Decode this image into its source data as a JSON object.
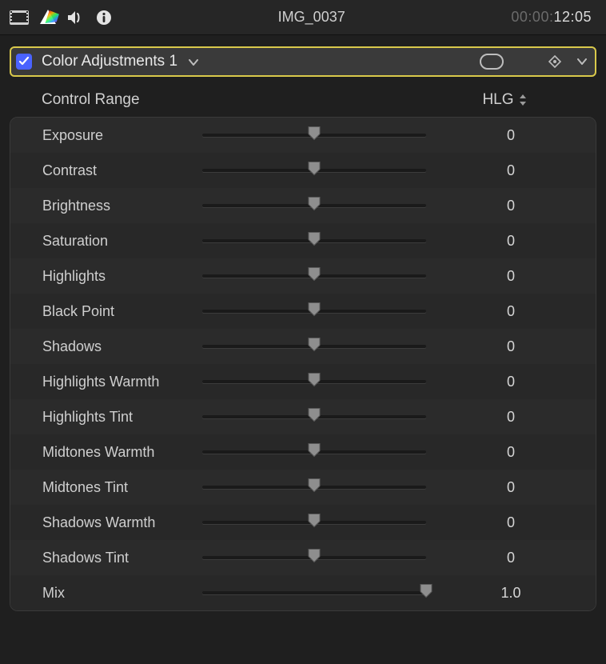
{
  "header": {
    "clip_title": "IMG_0037",
    "timecode_dim": "00:00:",
    "timecode_bright": "12:05"
  },
  "effect": {
    "enabled": true,
    "name": "Color Adjustments 1"
  },
  "control_range": {
    "label": "Control Range",
    "value": "HLG"
  },
  "params": [
    {
      "label": "Exposure",
      "value": "0",
      "pos": 0.5
    },
    {
      "label": "Contrast",
      "value": "0",
      "pos": 0.5
    },
    {
      "label": "Brightness",
      "value": "0",
      "pos": 0.5
    },
    {
      "label": "Saturation",
      "value": "0",
      "pos": 0.5
    },
    {
      "label": "Highlights",
      "value": "0",
      "pos": 0.5
    },
    {
      "label": "Black Point",
      "value": "0",
      "pos": 0.5
    },
    {
      "label": "Shadows",
      "value": "0",
      "pos": 0.5
    },
    {
      "label": "Highlights Warmth",
      "value": "0",
      "pos": 0.5
    },
    {
      "label": "Highlights Tint",
      "value": "0",
      "pos": 0.5
    },
    {
      "label": "Midtones Warmth",
      "value": "0",
      "pos": 0.5
    },
    {
      "label": "Midtones Tint",
      "value": "0",
      "pos": 0.5
    },
    {
      "label": "Shadows Warmth",
      "value": "0",
      "pos": 0.5
    },
    {
      "label": "Shadows Tint",
      "value": "0",
      "pos": 0.5
    },
    {
      "label": "Mix",
      "value": "1.0",
      "pos": 1.0
    }
  ]
}
